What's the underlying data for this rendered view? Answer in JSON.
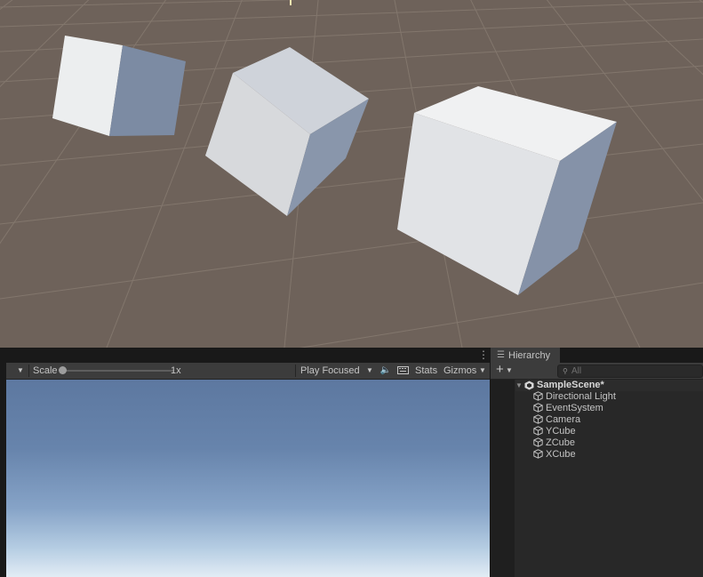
{
  "game_toolbar": {
    "scale_label": "Scale",
    "scale_value": "1x",
    "play_mode": "Play Focused",
    "stats_label": "Stats",
    "gizmos_label": "Gizmos"
  },
  "hierarchy": {
    "tab_label": "Hierarchy",
    "search_placeholder": "All",
    "scene_name": "SampleScene*",
    "items": [
      {
        "label": "Directional Light"
      },
      {
        "label": "EventSystem"
      },
      {
        "label": "Camera"
      },
      {
        "label": "YCube"
      },
      {
        "label": "ZCube"
      },
      {
        "label": "XCube"
      }
    ]
  },
  "colors": {
    "scene_ground": "#6e625a",
    "grid_line": "#8a8079",
    "editor_dark": "#191919",
    "toolbar": "#3c3c3c",
    "panel": "#282828",
    "sky_top": "#5d78a0",
    "sky_horizon": "#e2ecf5"
  },
  "icons": {
    "scene": "unity-scene-icon",
    "gameobject": "cube-outline-icon",
    "more": "kebab-menu-icon"
  }
}
